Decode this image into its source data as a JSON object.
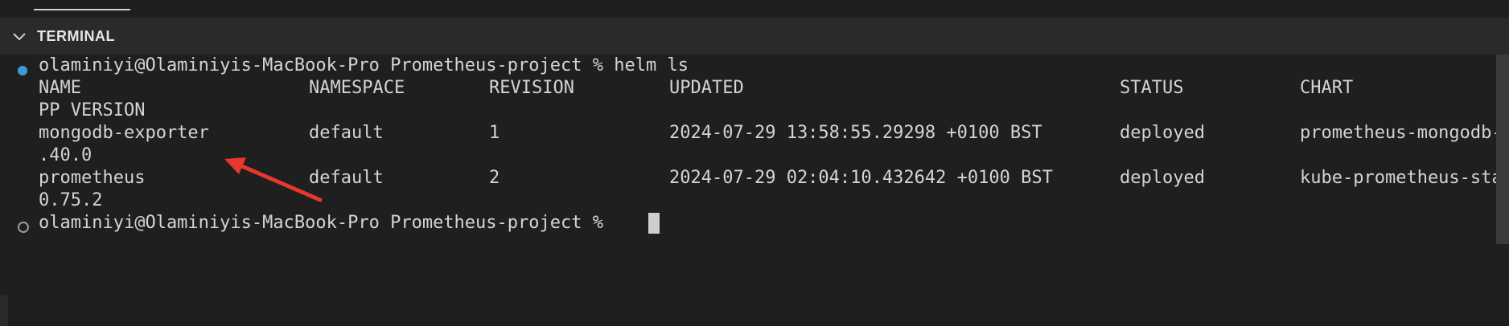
{
  "panel": {
    "title": "TERMINAL"
  },
  "terminal": {
    "command_line": {
      "prompt": "olaminiyi@Olaminiyis-MacBook-Pro Prometheus-project %",
      "command": "helm ls"
    },
    "headers": {
      "name": "NAME",
      "namespace": "NAMESPACE",
      "revision": "REVISION",
      "updated": "UPDATED",
      "status": "STATUS",
      "chart": "CHART",
      "app_version_wrap": "PP VERSION"
    },
    "rows": [
      {
        "name": "mongodb-exporter",
        "namespace": "default",
        "revision": "1",
        "updated": "2024-07-29 13:58:55.29298 +0100 BST",
        "status": "deployed",
        "chart": "prometheus-mongodb-",
        "wrap": ".40.0"
      },
      {
        "name": "prometheus",
        "namespace": "default",
        "revision": "2",
        "updated": "2024-07-29 02:04:10.432642 +0100 BST",
        "status": "deployed",
        "chart": "kube-prometheus-sta",
        "wrap": "0.75.2"
      }
    ],
    "final_prompt": "olaminiyi@Olaminiyis-MacBook-Pro Prometheus-project %"
  },
  "icons": {
    "collapse": "chevron-down-icon",
    "prompt_active": "prompt-success-dot-icon",
    "prompt_idle": "prompt-idle-dot-icon"
  },
  "colors": {
    "background": "#1f1f1f",
    "header_bg": "#2a2a2a",
    "prompt_dot": "#3c9bd6",
    "annotation_arrow": "#e8372c"
  }
}
